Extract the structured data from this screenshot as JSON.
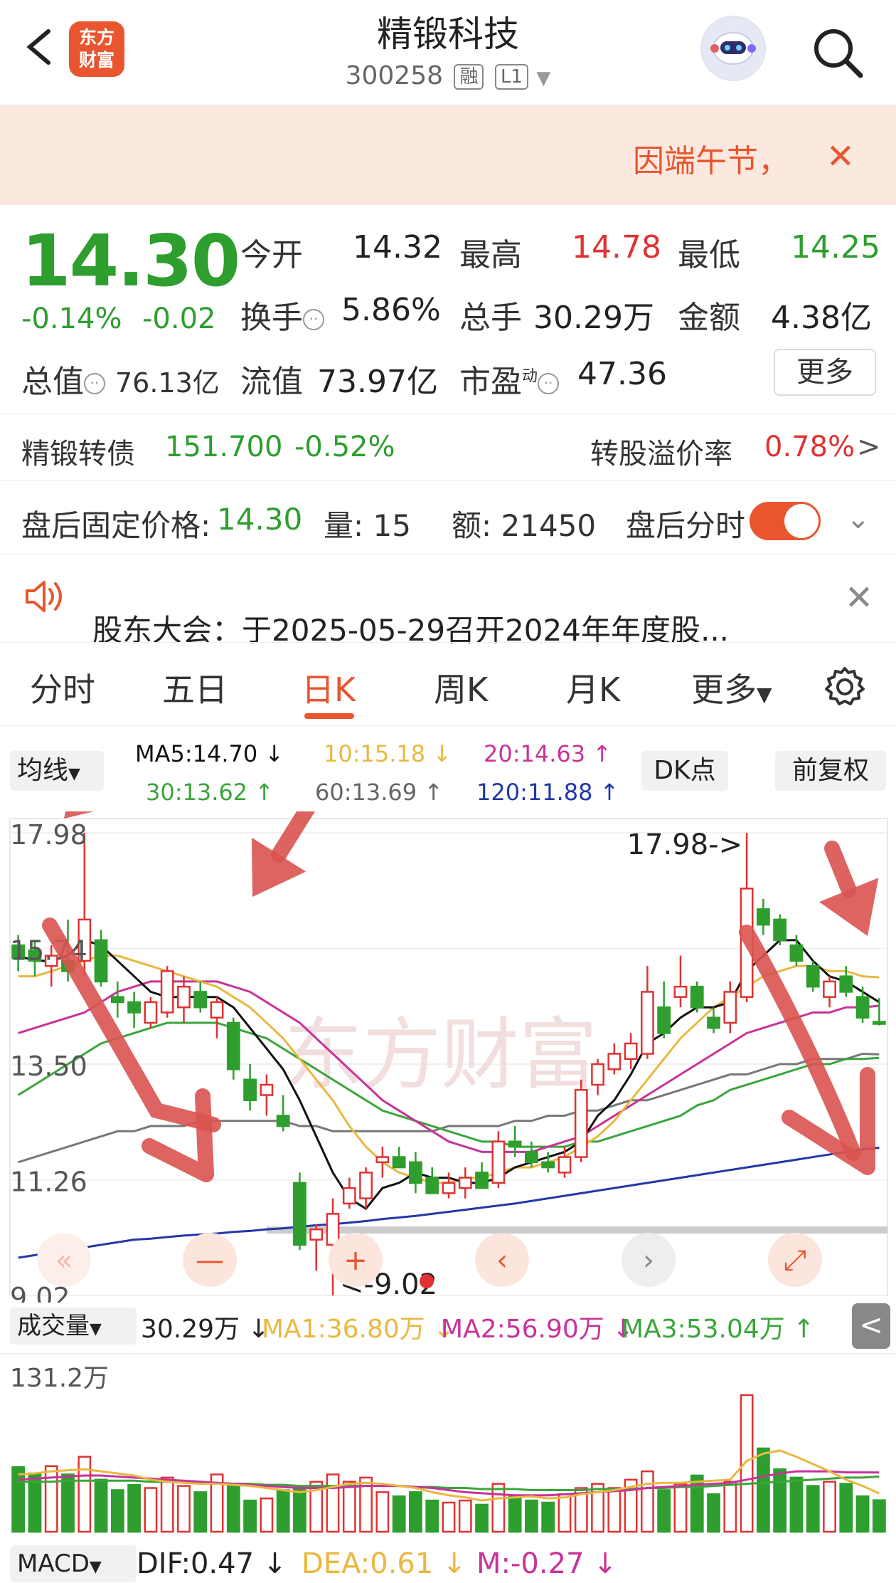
{
  "header": {
    "logo_text_line1": "东方",
    "logo_text_line2": "财富",
    "stock_name": "精锻科技",
    "stock_code": "300258",
    "tag_margin": "融",
    "tag_level": "L1"
  },
  "notice": {
    "text": "因端午节，",
    "close": "✕"
  },
  "quote": {
    "price": "14.30",
    "change_pct": "-0.14%",
    "change_amt": "-0.02",
    "open_label": "今开",
    "open": "14.32",
    "high_label": "最高",
    "high": "14.78",
    "low_label": "最低",
    "low": "14.25",
    "turnover_label": "换手",
    "turnover": "5.86%",
    "volume_label": "总手",
    "volume": "30.29万",
    "amount_label": "金额",
    "amount": "4.38亿",
    "mktcap_label": "总值",
    "mktcap": "76.13亿",
    "float_label": "流值",
    "float_cap": "73.97亿",
    "pe_label": "市盈",
    "pe_sup": "动",
    "pe": "47.36",
    "more": "更多"
  },
  "bond": {
    "label": "精锻转债",
    "price": "151.700",
    "pct": "-0.52%",
    "premium_label": "转股溢价率",
    "premium": "0.78%",
    "arrow": ">"
  },
  "after_hours": {
    "label": "盘后固定价格:",
    "price": "14.30",
    "vol_label": "量:",
    "vol": "15",
    "amt_label": "额:",
    "amt": "21450",
    "time_label": "盘后分时"
  },
  "announcement": {
    "text": "股东大会：于2025-05-29召开2024年年度股..."
  },
  "tabs": [
    "分时",
    "五日",
    "日K",
    "周K",
    "月K",
    "更多"
  ],
  "ma": {
    "selector": "均线",
    "ma5": "MA5:14.70 ↓",
    "ma10": "10:15.18 ↓",
    "ma20": "20:14.63 ↑",
    "ma30": "30:13.62 ↑",
    "ma60": "60:13.69 ↑",
    "ma120": "120:11.88 ↑",
    "dk_button": "DK点",
    "adjust_button": "前复权"
  },
  "colors": {
    "up": "#e03232",
    "down": "#2e9e2e",
    "accent": "#e8552e",
    "ma5": "#111111",
    "ma10": "#e9b840",
    "ma20": "#c8339a",
    "ma30": "#3aa53a",
    "ma60": "#777777",
    "ma120": "#2338a8"
  },
  "kchart": {
    "y_labels": [
      "17.98",
      "15.74",
      "13.50",
      "11.26",
      "9.02"
    ],
    "high_marker": "17.98->",
    "low_marker": "<-9.02",
    "watermark": "东方财富"
  },
  "volume": {
    "selector": "成交量",
    "vol": "30.29万 ↓",
    "ma1": "MA1:36.80万 ↓",
    "ma2": "MA2:56.90万 ↓",
    "ma3": "MA3:53.04万 ↑",
    "max_label": "131.2万",
    "collapse": "<"
  },
  "macd": {
    "selector": "MACD",
    "dif": "DIF:0.47 ↓",
    "dea": "DEA:0.61 ↓",
    "m": "M:-0.27 ↓"
  },
  "chart_data": {
    "type": "candlestick",
    "ylim": [
      9.02,
      17.98
    ],
    "candles": [
      {
        "o": 15.8,
        "h": 16.0,
        "l": 15.3,
        "c": 15.55
      },
      {
        "o": 15.7,
        "h": 15.9,
        "l": 15.2,
        "c": 15.5
      },
      {
        "o": 15.4,
        "h": 15.8,
        "l": 15.0,
        "c": 15.6
      },
      {
        "o": 15.5,
        "h": 16.3,
        "l": 15.1,
        "c": 15.3
      },
      {
        "o": 15.5,
        "h": 17.98,
        "l": 15.2,
        "c": 16.3
      },
      {
        "o": 15.9,
        "h": 16.1,
        "l": 15.0,
        "c": 15.1
      },
      {
        "o": 14.8,
        "h": 15.1,
        "l": 14.4,
        "c": 14.7
      },
      {
        "o": 14.7,
        "h": 14.9,
        "l": 14.2,
        "c": 14.5
      },
      {
        "o": 14.3,
        "h": 14.8,
        "l": 14.2,
        "c": 14.7
      },
      {
        "o": 14.5,
        "h": 15.4,
        "l": 14.4,
        "c": 15.3
      },
      {
        "o": 14.6,
        "h": 15.2,
        "l": 14.3,
        "c": 15.0
      },
      {
        "o": 14.9,
        "h": 15.1,
        "l": 14.5,
        "c": 14.6
      },
      {
        "o": 14.4,
        "h": 14.8,
        "l": 14.0,
        "c": 14.7
      },
      {
        "o": 14.3,
        "h": 14.4,
        "l": 13.2,
        "c": 13.4
      },
      {
        "o": 13.2,
        "h": 13.5,
        "l": 12.6,
        "c": 12.8
      },
      {
        "o": 12.9,
        "h": 13.3,
        "l": 12.5,
        "c": 13.1
      },
      {
        "o": 12.5,
        "h": 12.9,
        "l": 12.2,
        "c": 12.3
      },
      {
        "o": 11.2,
        "h": 11.4,
        "l": 9.9,
        "c": 10.0
      },
      {
        "o": 10.1,
        "h": 10.4,
        "l": 9.5,
        "c": 10.3
      },
      {
        "o": 10.0,
        "h": 10.9,
        "l": 9.02,
        "c": 10.6
      },
      {
        "o": 10.8,
        "h": 11.3,
        "l": 10.7,
        "c": 11.1
      },
      {
        "o": 10.9,
        "h": 11.5,
        "l": 10.7,
        "c": 11.4
      },
      {
        "o": 11.6,
        "h": 11.9,
        "l": 11.3,
        "c": 11.7
      },
      {
        "o": 11.7,
        "h": 11.9,
        "l": 11.5,
        "c": 11.5
      },
      {
        "o": 11.6,
        "h": 11.8,
        "l": 11.0,
        "c": 11.2
      },
      {
        "o": 11.3,
        "h": 11.5,
        "l": 11.0,
        "c": 11.0
      },
      {
        "o": 11.0,
        "h": 11.4,
        "l": 10.9,
        "c": 11.2
      },
      {
        "o": 11.1,
        "h": 11.5,
        "l": 10.9,
        "c": 11.3
      },
      {
        "o": 11.4,
        "h": 11.6,
        "l": 11.1,
        "c": 11.1
      },
      {
        "o": 11.2,
        "h": 12.2,
        "l": 11.1,
        "c": 12.0
      },
      {
        "o": 12.0,
        "h": 12.3,
        "l": 11.7,
        "c": 11.9
      },
      {
        "o": 11.8,
        "h": 12.0,
        "l": 11.5,
        "c": 11.6
      },
      {
        "o": 11.6,
        "h": 11.8,
        "l": 11.4,
        "c": 11.5
      },
      {
        "o": 11.4,
        "h": 11.9,
        "l": 11.3,
        "c": 11.7
      },
      {
        "o": 11.7,
        "h": 13.2,
        "l": 11.6,
        "c": 13.0
      },
      {
        "o": 13.1,
        "h": 13.6,
        "l": 12.9,
        "c": 13.5
      },
      {
        "o": 13.4,
        "h": 13.9,
        "l": 13.3,
        "c": 13.7
      },
      {
        "o": 13.6,
        "h": 14.1,
        "l": 13.4,
        "c": 13.9
      },
      {
        "o": 13.7,
        "h": 15.4,
        "l": 13.6,
        "c": 14.9
      },
      {
        "o": 14.6,
        "h": 15.1,
        "l": 14.0,
        "c": 14.1
      },
      {
        "o": 14.8,
        "h": 15.6,
        "l": 14.6,
        "c": 15.0
      },
      {
        "o": 15.0,
        "h": 15.1,
        "l": 14.5,
        "c": 14.6
      },
      {
        "o": 14.4,
        "h": 14.6,
        "l": 14.1,
        "c": 14.2
      },
      {
        "o": 14.3,
        "h": 15.1,
        "l": 14.1,
        "c": 14.9
      },
      {
        "o": 14.8,
        "h": 17.98,
        "l": 14.7,
        "c": 16.9
      },
      {
        "o": 16.5,
        "h": 16.7,
        "l": 16.0,
        "c": 16.2
      },
      {
        "o": 16.3,
        "h": 16.4,
        "l": 15.8,
        "c": 15.9
      },
      {
        "o": 15.8,
        "h": 16.0,
        "l": 15.4,
        "c": 15.5
      },
      {
        "o": 15.4,
        "h": 15.5,
        "l": 14.9,
        "c": 15.0
      },
      {
        "o": 14.8,
        "h": 15.2,
        "l": 14.6,
        "c": 15.1
      },
      {
        "o": 15.2,
        "h": 15.4,
        "l": 14.8,
        "c": 14.9
      },
      {
        "o": 14.8,
        "h": 15.0,
        "l": 14.3,
        "c": 14.4
      },
      {
        "o": 14.32,
        "h": 14.78,
        "l": 14.25,
        "c": 14.3
      }
    ],
    "ma5": [
      15.6,
      15.5,
      15.5,
      15.6,
      15.9,
      15.8,
      15.5,
      15.2,
      14.9,
      14.8,
      14.8,
      14.8,
      14.8,
      14.6,
      14.2,
      13.8,
      13.4,
      12.8,
      12.1,
      11.4,
      10.9,
      10.7,
      11.1,
      11.2,
      11.4,
      11.3,
      11.3,
      11.2,
      11.2,
      11.3,
      11.5,
      11.6,
      11.7,
      11.8,
      12.0,
      12.5,
      12.8,
      13.3,
      13.9,
      14.1,
      14.4,
      14.6,
      14.6,
      14.7,
      15.3,
      15.6,
      15.9,
      15.9,
      15.5,
      15.2,
      15.1,
      14.9,
      14.7
    ],
    "ma10": [
      15.2,
      15.2,
      15.3,
      15.4,
      15.5,
      15.6,
      15.6,
      15.5,
      15.4,
      15.3,
      15.2,
      15.1,
      15.0,
      14.8,
      14.6,
      14.3,
      14.0,
      13.6,
      13.2,
      12.8,
      12.3,
      11.9,
      11.6,
      11.4,
      11.3,
      11.2,
      11.2,
      11.3,
      11.3,
      11.4,
      11.5,
      11.5,
      11.6,
      11.7,
      11.9,
      12.1,
      12.4,
      12.8,
      13.2,
      13.6,
      14.0,
      14.3,
      14.6,
      14.8,
      15.0,
      15.2,
      15.3,
      15.4,
      15.4,
      15.3,
      15.3,
      15.2,
      15.18
    ],
    "ma20": [
      14.1,
      14.2,
      14.3,
      14.4,
      14.5,
      14.7,
      14.9,
      15.0,
      15.1,
      15.1,
      15.1,
      15.1,
      15.1,
      15.0,
      14.9,
      14.7,
      14.5,
      14.3,
      14.0,
      13.7,
      13.4,
      13.1,
      12.8,
      12.6,
      12.4,
      12.2,
      12.0,
      11.9,
      11.8,
      11.8,
      11.8,
      11.8,
      11.9,
      12.0,
      12.1,
      12.3,
      12.5,
      12.7,
      12.9,
      13.1,
      13.3,
      13.5,
      13.7,
      13.9,
      14.1,
      14.2,
      14.3,
      14.4,
      14.5,
      14.5,
      14.6,
      14.6,
      14.63
    ],
    "ma30": [
      12.9,
      13.1,
      13.3,
      13.5,
      13.7,
      13.9,
      14.0,
      14.1,
      14.2,
      14.3,
      14.3,
      14.3,
      14.3,
      14.2,
      14.1,
      14.0,
      13.8,
      13.6,
      13.4,
      13.2,
      13.0,
      12.8,
      12.6,
      12.5,
      12.4,
      12.3,
      12.2,
      12.1,
      12.0,
      12.0,
      11.9,
      11.9,
      11.9,
      11.9,
      12.0,
      12.0,
      12.1,
      12.2,
      12.3,
      12.4,
      12.5,
      12.7,
      12.8,
      13.0,
      13.1,
      13.2,
      13.3,
      13.4,
      13.5,
      13.5,
      13.6,
      13.6,
      13.62
    ],
    "ma60": [
      11.6,
      11.7,
      11.8,
      11.9,
      12.0,
      12.1,
      12.2,
      12.2,
      12.3,
      12.3,
      12.3,
      12.4,
      12.4,
      12.4,
      12.4,
      12.4,
      12.4,
      12.3,
      12.3,
      12.2,
      12.2,
      12.2,
      12.2,
      12.2,
      12.2,
      12.2,
      12.3,
      12.3,
      12.3,
      12.3,
      12.4,
      12.4,
      12.5,
      12.5,
      12.6,
      12.6,
      12.7,
      12.8,
      12.8,
      12.9,
      13.0,
      13.1,
      13.2,
      13.3,
      13.3,
      13.4,
      13.5,
      13.5,
      13.6,
      13.6,
      13.6,
      13.7,
      13.69
    ],
    "ma120": [
      9.75,
      9.8,
      9.85,
      9.9,
      9.95,
      10.0,
      10.05,
      10.1,
      10.12,
      10.15,
      10.18,
      10.2,
      10.22,
      10.25,
      10.27,
      10.3,
      10.32,
      10.35,
      10.38,
      10.4,
      10.43,
      10.46,
      10.5,
      10.53,
      10.56,
      10.6,
      10.64,
      10.68,
      10.72,
      10.76,
      10.8,
      10.85,
      10.9,
      10.95,
      11.0,
      11.05,
      11.1,
      11.15,
      11.2,
      11.25,
      11.3,
      11.35,
      11.4,
      11.45,
      11.5,
      11.55,
      11.6,
      11.65,
      11.7,
      11.75,
      11.8,
      11.85,
      11.88
    ],
    "volume": [
      62,
      56,
      63,
      55,
      72,
      50,
      40,
      45,
      42,
      52,
      44,
      38,
      55,
      45,
      30,
      32,
      40,
      42,
      48,
      55,
      48,
      52,
      38,
      34,
      38,
      30,
      28,
      30,
      26,
      46,
      34,
      30,
      28,
      36,
      42,
      46,
      42,
      50,
      58,
      40,
      46,
      54,
      36,
      48,
      131.2,
      80,
      60,
      52,
      44,
      48,
      46,
      34,
      30.29
    ],
    "vol_ma1": [
      55,
      56,
      58,
      59,
      60,
      58,
      56,
      54,
      50,
      48,
      47,
      46,
      46,
      45,
      44,
      42,
      40,
      38,
      40,
      43,
      46,
      47,
      46,
      44,
      42,
      38,
      35,
      33,
      30,
      32,
      33,
      34,
      32,
      33,
      36,
      38,
      40,
      43,
      46,
      47,
      47,
      48,
      49,
      50,
      68,
      75,
      78,
      72,
      65,
      58,
      50,
      44,
      36.8
    ],
    "vol_ma2": [
      50,
      51,
      52,
      53,
      54,
      54,
      53,
      52,
      51,
      50,
      49,
      48,
      47,
      46,
      45,
      44,
      43,
      42,
      42,
      42,
      43,
      44,
      44,
      44,
      43,
      42,
      40,
      38,
      37,
      36,
      35,
      35,
      35,
      36,
      37,
      38,
      39,
      40,
      42,
      43,
      44,
      45,
      46,
      47,
      50,
      53,
      56,
      58,
      58,
      58,
      57,
      57,
      56.9
    ],
    "vol_ma3": [
      48,
      48,
      48,
      49,
      49,
      49,
      49,
      49,
      48,
      48,
      48,
      47,
      47,
      46,
      46,
      45,
      45,
      44,
      44,
      44,
      44,
      44,
      44,
      44,
      43,
      43,
      42,
      42,
      41,
      41,
      41,
      40,
      40,
      40,
      40,
      41,
      41,
      41,
      42,
      42,
      43,
      43,
      44,
      45,
      46,
      47,
      48,
      49,
      50,
      51,
      52,
      52,
      53.04
    ]
  }
}
